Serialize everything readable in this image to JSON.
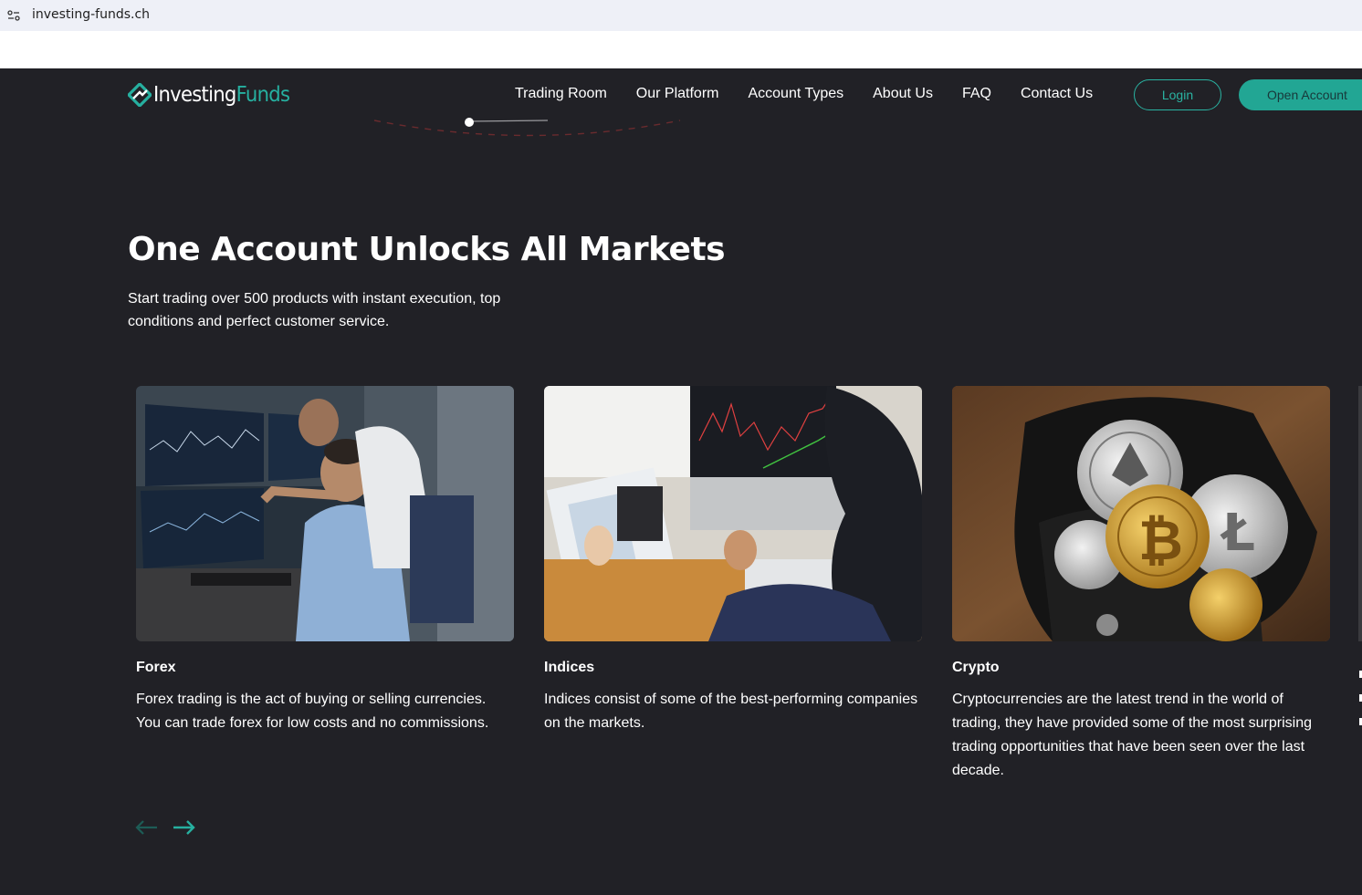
{
  "browser": {
    "url": "investing-funds.ch",
    "site_info_icon": "site-settings-icon"
  },
  "header": {
    "logo": {
      "main": "Investing",
      "accent": "Funds"
    },
    "nav": [
      "Trading Room",
      "Our Platform",
      "Account Types",
      "About Us",
      "FAQ",
      "Contact Us"
    ],
    "login_label": "Login",
    "open_account_label": "Open Account"
  },
  "hero": {
    "title": "One Account Unlocks All Markets",
    "subtitle": "Start trading over 500 products with instant execution, top conditions and perfect customer service."
  },
  "markets": [
    {
      "title": "Forex",
      "text": "Forex trading is the act of buying or selling currencies. You can trade forex for low costs and no commissions.",
      "image": "forex-traders-monitors-image"
    },
    {
      "title": "Indices",
      "text": "Indices consist of some of the best-performing companies on the markets.",
      "image": "indices-laptop-charts-image"
    },
    {
      "title": "Crypto",
      "text": "Cryptocurrencies are the latest trend in the world of trading, they have provided some of the most surprising trading opportunities that have been seen over the last decade.",
      "image": "crypto-coins-wallet-image"
    }
  ],
  "carousel": {
    "prev_icon": "arrow-left-icon",
    "next_icon": "arrow-right-icon"
  },
  "colors": {
    "background": "#212126",
    "accent": "#26b0a0",
    "text": "#ffffff"
  }
}
